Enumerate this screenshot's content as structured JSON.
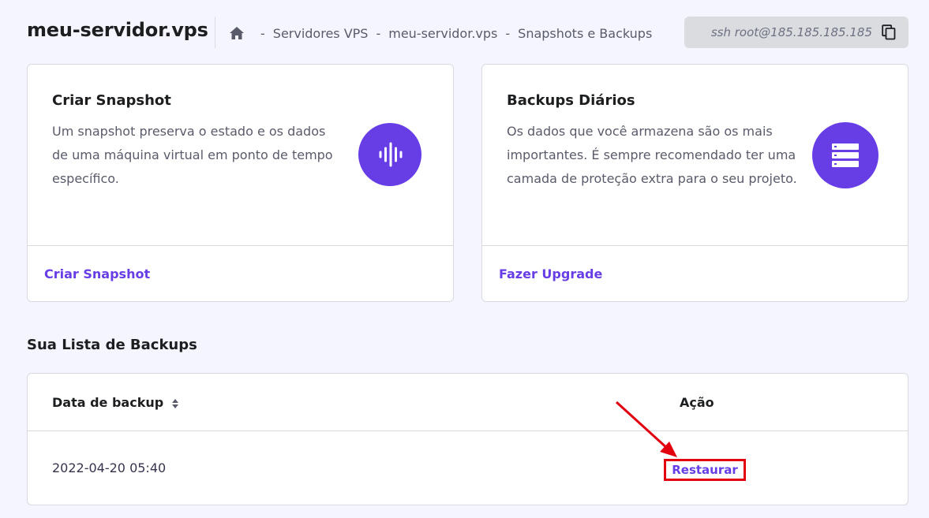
{
  "header": {
    "server_title": "meu-servidor.vps",
    "breadcrumb": {
      "items": [
        "Servidores VPS",
        "meu-servidor.vps",
        "Snapshots e Backups"
      ],
      "separator": "-"
    },
    "ssh_command": "ssh root@185.185.185.185"
  },
  "cards": {
    "snapshot": {
      "title": "Criar Snapshot",
      "description": "Um snapshot preserva o estado e os dados de uma máquina virtual em ponto de tempo específico.",
      "link_label": "Criar Snapshot",
      "icon": "audio-wave-icon"
    },
    "backup": {
      "title": "Backups Diários",
      "description": "Os dados que você armazena são os mais importantes. É sempre recomendado ter uma camada de proteção extra para o seu projeto.",
      "link_label": "Fazer Upgrade",
      "icon": "server-stack-icon"
    }
  },
  "backups_list": {
    "title": "Sua Lista de Backups",
    "columns": {
      "date": "Data de backup",
      "action": "Ação"
    },
    "rows": [
      {
        "date": "2022-04-20 05:40",
        "action_label": "Restaurar"
      }
    ]
  },
  "colors": {
    "accent": "#673de6",
    "annotation": "#e3000f",
    "background": "#f4f5ff"
  }
}
